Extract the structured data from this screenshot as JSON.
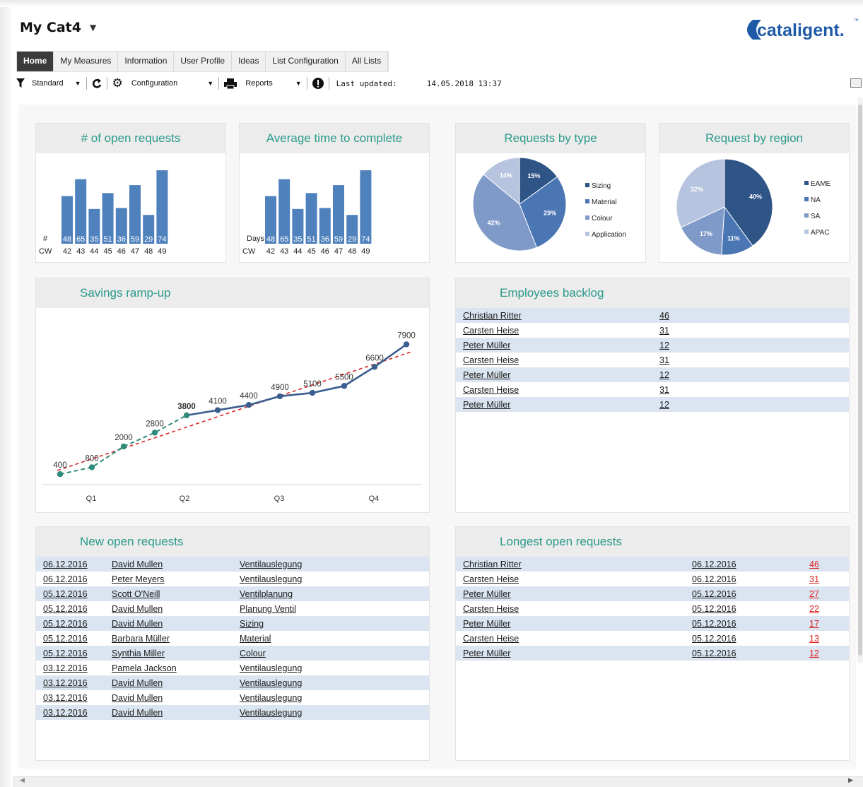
{
  "app": {
    "title": "My Cat4",
    "logo_text": "cataligent.",
    "logo_tm": "™"
  },
  "nav": {
    "tabs": [
      "Home",
      "My Measures",
      "Information",
      "User Profile",
      "Ideas",
      "List Configuration",
      "All Lists"
    ],
    "active": 0
  },
  "toolbar": {
    "filter_label": "Standard",
    "config_label": "Configuration",
    "reports_label": "Reports",
    "last_updated_label": "Last updated:",
    "last_updated_value": "14.05.2018 13:37"
  },
  "panels": {
    "open_requests": {
      "title": "# of open requests",
      "row_label": "#",
      "axis_label": "CW"
    },
    "avg_time": {
      "title": "Average time to complete",
      "row_label": "Days",
      "axis_label": "CW"
    },
    "by_type": {
      "title": "Requests by type"
    },
    "by_region": {
      "title": "Request by region"
    },
    "savings": {
      "title": "Savings ramp-up"
    },
    "backlog": {
      "title": "Employees backlog",
      "rows": [
        {
          "name": "Christian Ritter",
          "count": "46"
        },
        {
          "name": "Carsten Heise",
          "count": "31"
        },
        {
          "name": "Peter Müller",
          "count": "12"
        },
        {
          "name": "Carsten Heise",
          "count": "31"
        },
        {
          "name": "Peter Müller",
          "count": "12"
        },
        {
          "name": "Carsten Heise",
          "count": "31"
        },
        {
          "name": "Peter Müller",
          "count": "12"
        }
      ]
    },
    "new_open": {
      "title": "New open requests",
      "rows": [
        {
          "date": "06.12.2016",
          "name": "David Mullen",
          "topic": "Ventilauslegung"
        },
        {
          "date": "06.12.2016",
          "name": "Peter Meyers",
          "topic": "Ventilauslegung"
        },
        {
          "date": "05.12.2016",
          "name": "Scott O'Neill",
          "topic": "Ventilplanung"
        },
        {
          "date": "05.12.2016",
          "name": "David Mullen",
          "topic": "Planung Ventil"
        },
        {
          "date": "05.12.2016",
          "name": "David Mullen",
          "topic": "Sizing"
        },
        {
          "date": "05.12.2016",
          "name": "Barbara Müller",
          "topic": "Material"
        },
        {
          "date": "05.12.2016",
          "name": "Synthia Miller",
          "topic": "Colour"
        },
        {
          "date": "03.12.2016",
          "name": "Pamela Jackson",
          "topic": "Ventilauslegung"
        },
        {
          "date": "03.12.2016",
          "name": "David Mullen",
          "topic": "Ventilauslegung"
        },
        {
          "date": "03.12.2016",
          "name": "David Mullen",
          "topic": "Ventilauslegung"
        },
        {
          "date": "03.12.2016",
          "name": "David Mullen",
          "topic": "Ventilauslegung"
        }
      ]
    },
    "longest": {
      "title": "Longest open requests",
      "rows": [
        {
          "name": "Christian Ritter",
          "date": "06.12.2016",
          "days": "46"
        },
        {
          "name": "Carsten Heise",
          "date": "06.12.2016",
          "days": "31"
        },
        {
          "name": "Peter Müller",
          "date": "05.12.2016",
          "days": "27"
        },
        {
          "name": "Carsten Heise",
          "date": "05.12.2016",
          "days": "22"
        },
        {
          "name": "Peter Müller",
          "date": "05.12.2016",
          "days": "17"
        },
        {
          "name": "Carsten Heise",
          "date": "05.12.2016",
          "days": "13"
        },
        {
          "name": "Peter Müller",
          "date": "05.12.2016",
          "days": "12"
        }
      ]
    }
  },
  "colors": {
    "accent": "#2b9a8a",
    "bar": "#4f81bd",
    "line": "#3b5d8f",
    "teal": "#2e8b7a",
    "trend": "#d62728",
    "row_alt": "#dbe5f1"
  },
  "chart_data": [
    {
      "type": "bar",
      "title": "# of open requests",
      "xlabel": "CW",
      "categories": [
        "42",
        "43",
        "44",
        "45",
        "46",
        "47",
        "48",
        "49"
      ],
      "values": [
        48,
        65,
        35,
        51,
        36,
        59,
        29,
        74
      ]
    },
    {
      "type": "bar",
      "title": "Average time to complete",
      "xlabel": "CW",
      "ylabel": "Days",
      "categories": [
        "42",
        "43",
        "44",
        "45",
        "46",
        "47",
        "48",
        "49"
      ],
      "values": [
        48,
        65,
        35,
        51,
        36,
        59,
        29,
        74
      ]
    },
    {
      "type": "pie",
      "title": "Requests by type",
      "labels": [
        "Sizing",
        "Material",
        "Colour",
        "Application"
      ],
      "values": [
        15,
        29,
        42,
        14
      ],
      "value_labels": [
        "15%",
        "29%",
        "42%",
        "14%"
      ],
      "colors": [
        "#2f5486",
        "#4a76b3",
        "#7f99c8",
        "#b7c4df"
      ],
      "legend": "right"
    },
    {
      "type": "pie",
      "title": "Request by region",
      "labels": [
        "EAME",
        "NA",
        "SA",
        "APAC"
      ],
      "values": [
        40,
        11,
        17,
        32
      ],
      "value_labels": [
        "40%",
        "11%",
        "17%",
        "32%"
      ],
      "colors": [
        "#2f5486",
        "#4a76b3",
        "#7f99c8",
        "#b7c4df"
      ],
      "legend": "right"
    },
    {
      "type": "line",
      "title": "Savings ramp-up",
      "categories": [
        "Q1",
        "Q2",
        "Q3",
        "Q4"
      ],
      "ylim": [
        0,
        8400
      ],
      "series": [
        {
          "style": "teal-dashed",
          "values": [
            400,
            800,
            2000,
            2800,
            3800
          ]
        },
        {
          "style": "solid",
          "values": [
            3800,
            4100,
            4400,
            4900,
            5100,
            5500,
            6600,
            7900
          ]
        }
      ],
      "point_labels": [
        "400",
        "800",
        "2000",
        "2800",
        "3800",
        "4100",
        "4400",
        "4900",
        "5100",
        "5500",
        "6600",
        "7900"
      ],
      "trendline": true
    }
  ]
}
